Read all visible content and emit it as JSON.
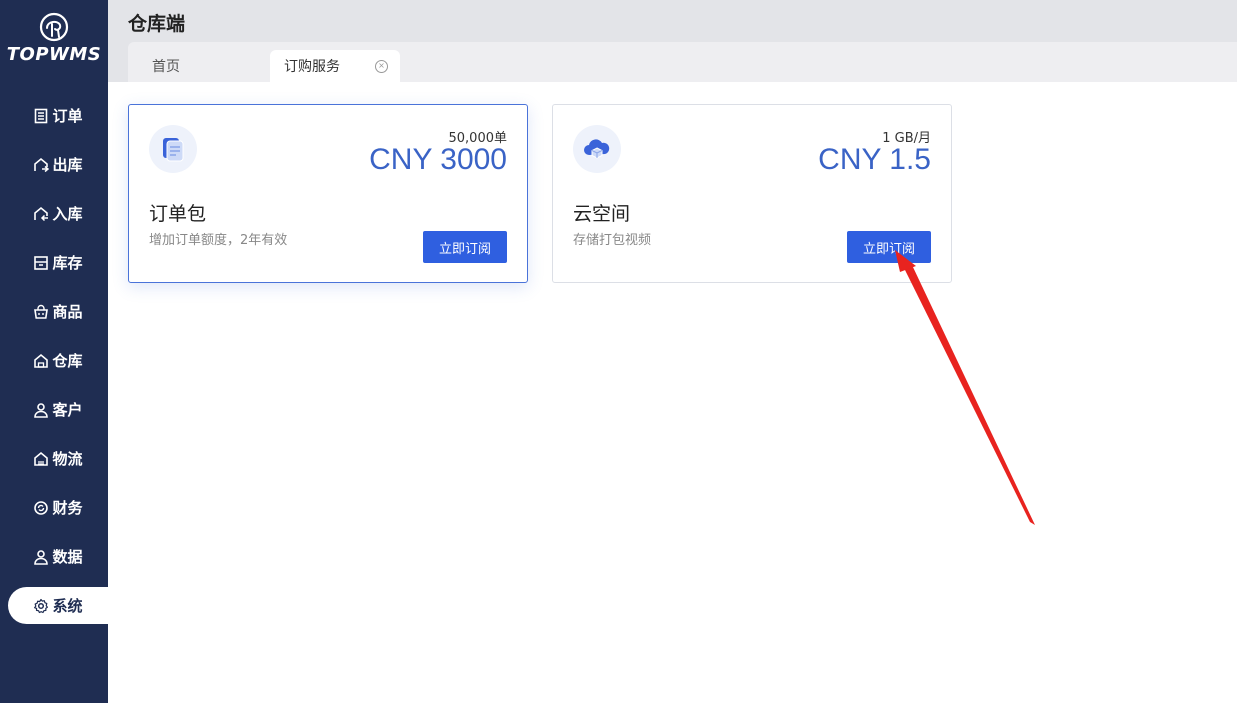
{
  "app": {
    "logo_text": "TOPWMS",
    "title": "仓库端"
  },
  "sidebar": {
    "items": [
      {
        "label": "订单",
        "icon": "document-list-icon"
      },
      {
        "label": "出库",
        "icon": "house-out-icon"
      },
      {
        "label": "入库",
        "icon": "house-in-icon"
      },
      {
        "label": "库存",
        "icon": "inventory-box-icon"
      },
      {
        "label": "商品",
        "icon": "shopping-basket-icon"
      },
      {
        "label": "仓库",
        "icon": "warehouse-icon"
      },
      {
        "label": "客户",
        "icon": "user-icon"
      },
      {
        "label": "物流",
        "icon": "logistics-icon"
      },
      {
        "label": "财务",
        "icon": "finance-cycle-icon"
      },
      {
        "label": "数据",
        "icon": "data-user-icon"
      },
      {
        "label": "系统",
        "icon": "gear-icon",
        "active": true
      }
    ]
  },
  "tabs": {
    "home": "首页",
    "active": "订购服务"
  },
  "cards": [
    {
      "icon": "document-stack-icon",
      "quantity": "50,000单",
      "price": "CNY 3000",
      "name": "订单包",
      "description": "增加订单额度，2年有效",
      "button": "立即订阅",
      "selected": true
    },
    {
      "icon": "cloud-storage-icon",
      "quantity": "1 GB/月",
      "price": "CNY 1.5",
      "name": "云空间",
      "description": "存储打包视频",
      "button": "立即订阅",
      "selected": false
    }
  ],
  "colors": {
    "sidebar_bg": "#1f2d52",
    "accent": "#2f5fe0",
    "price": "#3a63c6",
    "annotation": "#e8231f"
  }
}
